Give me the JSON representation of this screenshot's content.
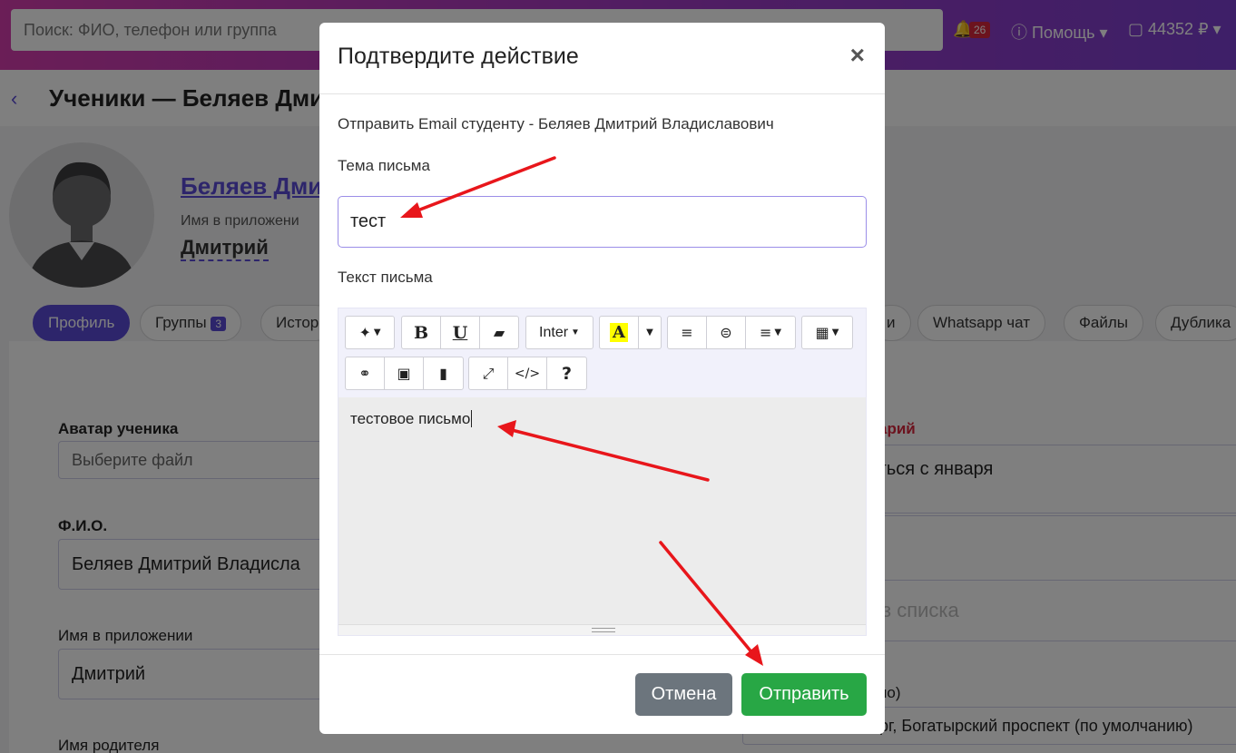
{
  "header": {
    "search_placeholder": "Поиск: ФИО, телефон или группа",
    "notifications_count": "26",
    "help_label": "Помощь",
    "balance": "44352 ₽"
  },
  "page": {
    "title": "Ученики — Беляев Дми",
    "student_name_link": "Беляев Дми",
    "app_name_caption": "Имя в приложени",
    "app_name_value": "Дмитрий"
  },
  "tabs": [
    {
      "label": "Профиль"
    },
    {
      "label": "Группы",
      "count": "3"
    },
    {
      "label": "Истор"
    },
    {
      "label": "и"
    },
    {
      "label": "Whatsapp чат"
    },
    {
      "label": "Файлы"
    },
    {
      "label": "Дублика"
    }
  ],
  "form": {
    "avatar_label": "Аватар ученика",
    "avatar_placeholder": "Выберите файл",
    "fio_label": "Ф.И.О.",
    "fio_value": "Беляев Дмитрий Владисла",
    "app_name_label": "Имя в приложении",
    "app_name_value": "Дмитрий",
    "parent_label": "Имя родителя",
    "comment_label": "арий",
    "comment_value": "аться с января",
    "list_placeholder": "з списка",
    "default_hint": "но)",
    "branch_value": "рг, Богатырский проспект (по умолчанию)"
  },
  "modal": {
    "title": "Подтвердите действие",
    "close": "×",
    "description": "Отправить Email студенту - Беляев Дмитрий Владиславович",
    "subject_label": "Тема письма",
    "subject_value": "тест",
    "text_label": "Текст письма",
    "body_text": "тестовое письмо",
    "toolbar": {
      "font_name": "Inter",
      "bold": "B",
      "underline": "U",
      "help": "?"
    },
    "cancel_label": "Отмена",
    "send_label": "Отправить"
  },
  "colors": {
    "accent": "#5b4bd6",
    "send": "#28a745",
    "cancel": "#6c757d",
    "arrow": "#e8161b"
  }
}
